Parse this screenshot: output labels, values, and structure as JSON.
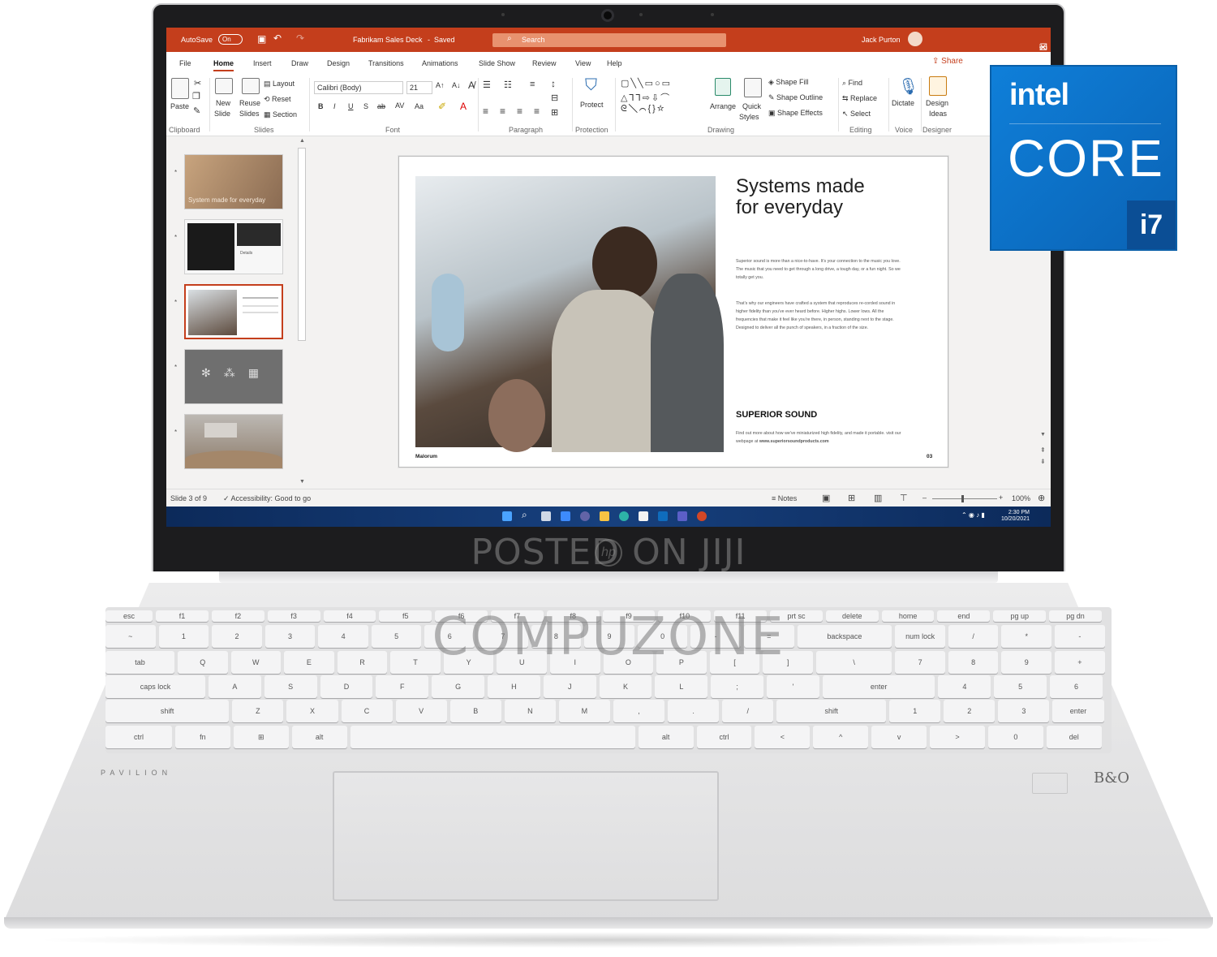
{
  "titlebar": {
    "autosave": "AutoSave",
    "autosave_state": "On",
    "doc_title": "Fabrikam Sales Deck",
    "saved": "Saved",
    "search": "Search",
    "user": "Jack Purton",
    "accent": "#c43e1c"
  },
  "menu": {
    "file": "File",
    "home": "Home",
    "insert": "Insert",
    "draw": "Draw",
    "design": "Design",
    "transitions": "Transitions",
    "animations": "Animations",
    "slideshow": "Slide Show",
    "review": "Review",
    "view": "View",
    "help": "Help",
    "share": "Share"
  },
  "ribbon": {
    "paste": "Paste",
    "new": "New",
    "slide": "Slide",
    "reuse": "Reuse",
    "slides": "Slides",
    "layout": "Layout",
    "reset": "Reset",
    "section": "Section",
    "font_name": "Calibri (Body)",
    "font_size": "21",
    "protect": "Protect",
    "arrange": "Arrange",
    "quick": "Quick",
    "styles": "Styles",
    "shape_fill": "Shape Fill",
    "shape_outline": "Shape Outline",
    "shape_effects": "Shape Effects",
    "find": "Find",
    "replace": "Replace",
    "select": "Select",
    "dictate": "Dictate",
    "design": "Design",
    "ideas": "Ideas",
    "groups": {
      "clipboard": "Clipboard",
      "slides": "Slides",
      "font": "Font",
      "paragraph": "Paragraph",
      "protection": "Protection",
      "drawing": "Drawing",
      "editing": "Editing",
      "voice": "Voice",
      "designer": "Designer"
    }
  },
  "thumbnails": [
    {
      "caption": "System made for everyday"
    },
    {
      "caption": "Details"
    },
    {
      "caption": ""
    },
    {
      "caption": ""
    },
    {
      "caption": ""
    }
  ],
  "slide": {
    "title_line1": "Systems made",
    "title_line2": "for everyday",
    "para1": "Superior sound is more than a nice-to-have. It's your connection to the music you love. The music that you need to get through a long drive, a tough day, or a fun night. So we totally get you.",
    "para2": "That's why our engineers have crafted a system that reproduces re-corded sound in higher fidelity than you've ever heard before. Higher highs. Lower lows. All the frequencies that make it feel like you're there, in person, standing next to the stage. Designed to deliver all the punch of speakers, in a fraction of the size.",
    "heading": "SUPERIOR SOUND",
    "para3_a": "Find out more about how we've miniaturized high fidelity, and made it portable. visit our webpage at",
    "para3_b": "www.superiorsoundproducts.com",
    "footer_left": "Malorum",
    "footer_num": "03"
  },
  "status": {
    "slide_count": "Slide 3 of 9",
    "accessibility": "Accessibility: Good to go",
    "notes": "Notes",
    "zoom": "100%"
  },
  "taskbar": {
    "time": "2:30 PM",
    "date": "10/20/2021"
  },
  "badge": {
    "brand": "intel",
    "line": "CORE",
    "gen": "i7",
    "color": "#0a74c9"
  },
  "laptop": {
    "model": "PAVILION",
    "audio_logo": "B&O",
    "watermark_top": "POSTED ON JIJI",
    "watermark_mid": "COMPUZONE"
  },
  "keyboard": {
    "row1": [
      "esc",
      "f1",
      "f2",
      "f3",
      "f4",
      "f5",
      "f6",
      "f7",
      "f8",
      "f9",
      "f10",
      "f11",
      "prt sc",
      "delete",
      "home",
      "end",
      "pg up",
      "pg dn"
    ],
    "row2": [
      "~",
      "1",
      "2",
      "3",
      "4",
      "5",
      "6",
      "7",
      "8",
      "9",
      "0",
      "-",
      "=",
      "backspace",
      "num lock",
      "/",
      "*",
      "-"
    ],
    "row3": [
      "tab",
      "Q",
      "W",
      "E",
      "R",
      "T",
      "Y",
      "U",
      "I",
      "O",
      "P",
      "[",
      "]",
      "\\",
      "7",
      "8",
      "9",
      "+"
    ],
    "row4": [
      "caps lock",
      "A",
      "S",
      "D",
      "F",
      "G",
      "H",
      "J",
      "K",
      "L",
      ";",
      "'",
      "enter",
      "4",
      "5",
      "6"
    ],
    "row5": [
      "shift",
      "Z",
      "X",
      "C",
      "V",
      "B",
      "N",
      "M",
      ",",
      ".",
      "/",
      "shift",
      "1",
      "2",
      "3",
      "enter"
    ],
    "row6": [
      "ctrl",
      "fn",
      "win",
      "alt",
      "",
      "alt",
      "ctrl",
      "<",
      "^",
      "v",
      ">",
      "0",
      "del"
    ]
  }
}
